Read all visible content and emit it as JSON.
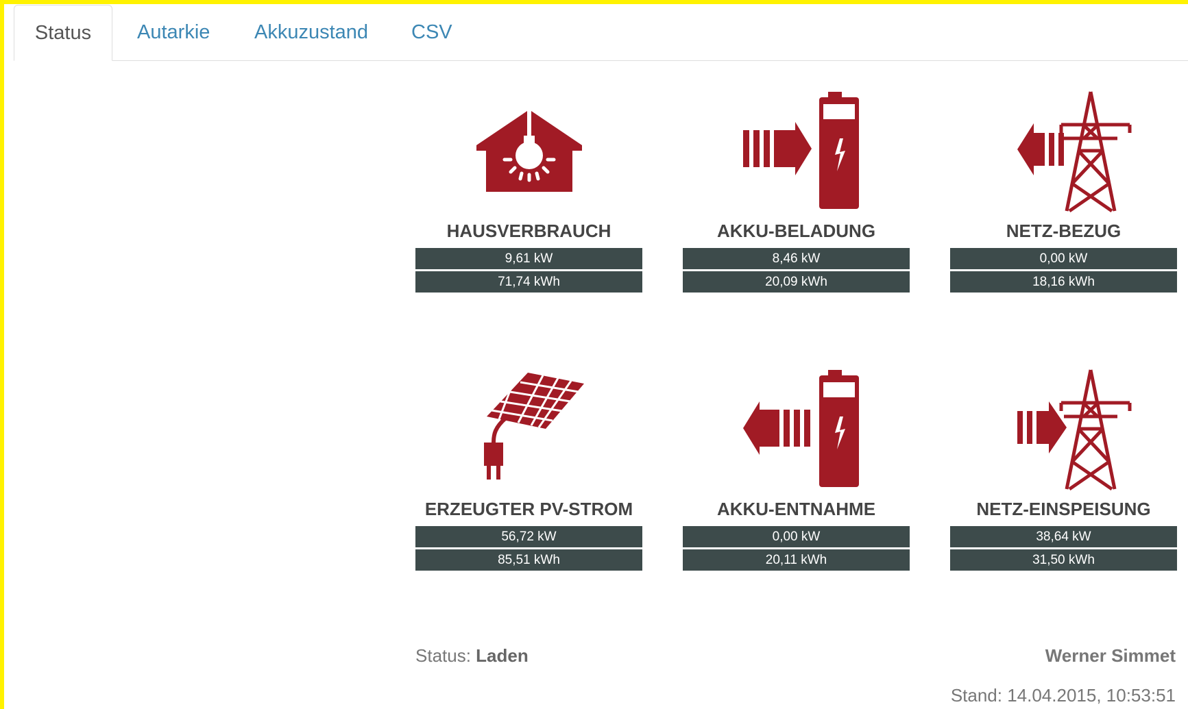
{
  "tabs": [
    {
      "label": "Status",
      "active": true
    },
    {
      "label": "Autarkie",
      "active": false
    },
    {
      "label": "Akkuzustand",
      "active": false
    },
    {
      "label": "CSV",
      "active": false
    }
  ],
  "tiles": [
    {
      "icon": "house-lightbulb-icon",
      "title": "HAUSVERBRAUCH",
      "kw": "9,61 kW",
      "kwh": "71,74 kWh"
    },
    {
      "icon": "battery-charging-icon",
      "title": "AKKU-BELADUNG",
      "kw": "8,46 kW",
      "kwh": "20,09 kWh"
    },
    {
      "icon": "grid-import-icon",
      "title": "NETZ-BEZUG",
      "kw": "0,00 kW",
      "kwh": "18,16 kWh"
    },
    {
      "icon": "solar-panel-plug-icon",
      "title": "ERZEUGTER PV-STROM",
      "kw": "56,72 kW",
      "kwh": "85,51 kWh"
    },
    {
      "icon": "battery-discharging-icon",
      "title": "AKKU-ENTNAHME",
      "kw": "0,00 kW",
      "kwh": "20,11 kWh"
    },
    {
      "icon": "grid-export-icon",
      "title": "NETZ-EINSPEISUNG",
      "kw": "38,64 kW",
      "kwh": "31,50 kWh"
    }
  ],
  "footer": {
    "status_label": "Status:",
    "status_value": "Laden",
    "name": "Werner Simmet",
    "stand": "Stand: 14.04.2015, 10:53:51"
  },
  "colors": {
    "icon": "#a11b25",
    "value_bar": "#3d4b4b",
    "tab_link": "#3c87b4",
    "frame": "#fff200"
  }
}
